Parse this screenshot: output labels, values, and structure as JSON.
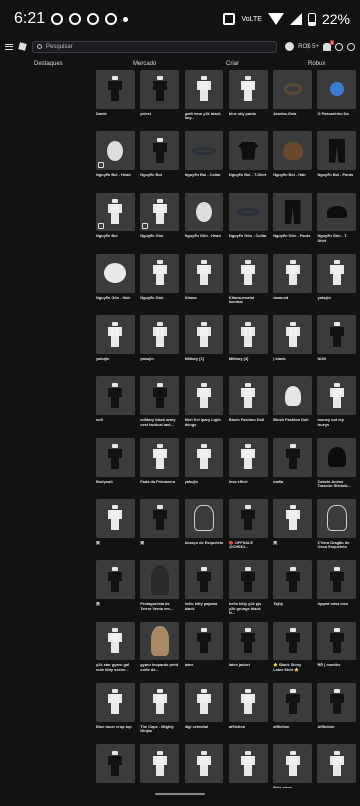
{
  "status_bar": {
    "time": "6:21",
    "volte": "VoLTE",
    "battery": "22%"
  },
  "search": {
    "placeholder": "Pesquisar"
  },
  "header": {
    "robux_count": "RO$ 5+",
    "notifications_badge": "5"
  },
  "tabs": [
    "Destaques",
    "Mercado",
    "Criar",
    "Robux"
  ],
  "items": [
    {
      "label": "Dante",
      "icon": "dark-figure-icon"
    },
    {
      "label": "priest",
      "icon": "dark-figure-icon"
    },
    {
      "label": "goth emo y2k black boy...",
      "icon": "figure-icon"
    },
    {
      "label": "blue sky pants",
      "icon": "figure-icon"
    },
    {
      "label": "Aranha-Gela",
      "icon": "spider-icon"
    },
    {
      "label": "O Passarinho Da",
      "icon": "bird-icon"
    },
    {
      "label": "Nguyễn Boi - Head",
      "icon": "mask-icon",
      "tag": true
    },
    {
      "label": "Nguyễn Boi",
      "icon": "dark-figure-icon"
    },
    {
      "label": "Nguyễn Boi - Collar",
      "icon": "collar-icon"
    },
    {
      "label": "Nguyễn Boi - T-Shirt",
      "icon": "shirt-icon"
    },
    {
      "label": "Nguyễn Boi - Hair",
      "icon": "hair-icon"
    },
    {
      "label": "Nguyễn Boi - Pants",
      "icon": "pants-icon"
    },
    {
      "label": "Nguyễn Boi",
      "icon": "figure-icon",
      "tag": true
    },
    {
      "label": "Nguyễn Gôn",
      "icon": "figure-icon",
      "tag": true
    },
    {
      "label": "Nguyễn Gôn - Head",
      "icon": "mask-icon"
    },
    {
      "label": "Nguyễn Gôn - Collar",
      "icon": "collar-icon"
    },
    {
      "label": "Nguyễn Gôn - Pants",
      "icon": "pants-icon"
    },
    {
      "label": "Nguyễn Gôn - T-Shirt",
      "icon": "hat-icon"
    },
    {
      "label": "Nguyễn Gôn - Hair",
      "icon": "white-hair-icon"
    },
    {
      "label": "Nguyễn Gôn",
      "icon": "figure-icon"
    },
    {
      "label": "Kitana",
      "icon": "figure-icon"
    },
    {
      "label": "Kitana-mortal kombat",
      "icon": "figure-icon"
    },
    {
      "label": "damned",
      "icon": "figure-icon"
    },
    {
      "label": "yakujin",
      "icon": "figure-icon"
    },
    {
      "label": "yakujin",
      "icon": "figure-icon"
    },
    {
      "label": "yakujin",
      "icon": "figure-icon"
    },
    {
      "label": "Military [1]",
      "icon": "figure-icon"
    },
    {
      "label": "Military [4]",
      "icon": "figure-icon"
    },
    {
      "label": "| blank",
      "icon": "figure-icon"
    },
    {
      "label": "NUN",
      "icon": "dark-figure-icon"
    },
    {
      "label": "sufi",
      "icon": "dark-figure-icon"
    },
    {
      "label": "military black army vest tactical tact...",
      "icon": "dark-figure-icon"
    },
    {
      "label": "Meri Kei ipary Light things",
      "icon": "figure-icon"
    },
    {
      "label": "Blush Fashion Doll",
      "icon": "figure-icon"
    },
    {
      "label": "Blush Fashion Doll",
      "icon": "skull-icon"
    },
    {
      "label": "money out my trueys",
      "icon": "figure-icon"
    },
    {
      "label": "Bodysuit",
      "icon": "dark-figure-icon"
    },
    {
      "label": "Fada da Primavera",
      "icon": "figure-icon"
    },
    {
      "label": "yakujin",
      "icon": "figure-icon"
    },
    {
      "label": "less effort",
      "icon": "figure-icon"
    },
    {
      "label": "mafia",
      "icon": "dark-figure-icon"
    },
    {
      "label": "Cabelo Anime Traseiro Stickeb...",
      "icon": "black-hair-icon"
    },
    {
      "label": "美",
      "icon": "figure-icon"
    },
    {
      "label": "美",
      "icon": "dark-figure-icon"
    },
    {
      "label": "Abraço de Esqueleto",
      "icon": "skeleton-icon"
    },
    {
      "label": "🔴 OFFSALE @CHEDI...",
      "icon": "dark-figure-icon"
    },
    {
      "label": "美",
      "icon": "figure-icon"
    },
    {
      "label": "Z'Vora Dragão de Osso Esqueleto",
      "icon": "skeleton-icon"
    },
    {
      "label": "美",
      "icon": "dark-figure-icon"
    },
    {
      "label": "Protagonista de Terror Vento em...",
      "icon": "long-hair-icon"
    },
    {
      "label": "hello kitty pajama black",
      "icon": "dark-figure-icon"
    },
    {
      "label": "hello kitty y2k pjs y2k grunge black N...",
      "icon": "dark-figure-icon"
    },
    {
      "label": "Tajhy",
      "icon": "dark-figure-icon"
    },
    {
      "label": "ripped miss mes",
      "icon": "dark-figure-icon"
    },
    {
      "label": "y2k star gyaru gal cute kitty scene...",
      "icon": "figure-icon"
    },
    {
      "label": "gyaru leopardo print corte de...",
      "icon": "brown-hair-icon"
    },
    {
      "label": "latex",
      "icon": "dark-figure-icon"
    },
    {
      "label": "latex jacket",
      "icon": "dark-figure-icon"
    },
    {
      "label": "⭐ Black Shiny Latex Shirt ⭐",
      "icon": "dark-figure-icon"
    },
    {
      "label": "ᕼᐱ | months",
      "icon": "dark-figure-icon"
    },
    {
      "label": "Blue racer crop top",
      "icon": "figure-icon"
    },
    {
      "label": "The Cape - Mighty Ninjas",
      "icon": "figure-icon"
    },
    {
      "label": "digi celestial",
      "icon": "figure-icon"
    },
    {
      "label": "affliction",
      "icon": "figure-icon"
    },
    {
      "label": "affliction",
      "icon": "dark-figure-icon"
    },
    {
      "label": "Affliction",
      "icon": "dark-figure-icon"
    },
    {
      "label": "",
      "icon": "dark-figure-icon"
    },
    {
      "label": "",
      "icon": "figure-icon"
    },
    {
      "label": "",
      "icon": "figure-icon"
    },
    {
      "label": "",
      "icon": "figure-icon"
    },
    {
      "label": "Beie-papo",
      "icon": "figure-icon"
    },
    {
      "label": "",
      "icon": "figure-icon"
    }
  ]
}
